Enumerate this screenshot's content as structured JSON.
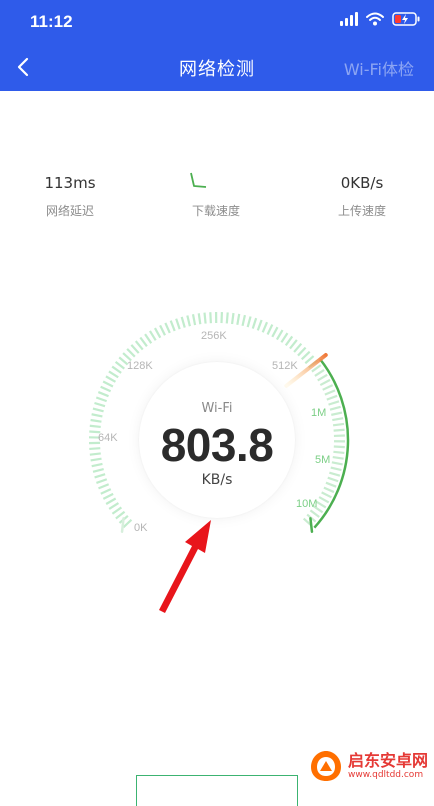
{
  "status_bar": {
    "time": "11:12"
  },
  "header": {
    "title": "网络检测",
    "action_label": "Wi-Fi体检"
  },
  "stats": {
    "latency": {
      "value": "113ms",
      "label": "网络延迟"
    },
    "download": {
      "value": "",
      "label": "下载速度"
    },
    "upload": {
      "value": "0KB/s",
      "label": "上传速度"
    }
  },
  "gauge": {
    "network": "Wi-Fi",
    "speed": "803.8",
    "unit": "KB/s",
    "scale": [
      "0K",
      "64K",
      "128K",
      "256K",
      "512K",
      "1M",
      "5M",
      "10M"
    ]
  },
  "watermark": {
    "title": "启东安卓网",
    "url": "www.qdltdd.com"
  },
  "colors": {
    "header_bg": "#2f5bea",
    "gauge_green": "#4caf50",
    "arrow_red": "#e8151b"
  }
}
